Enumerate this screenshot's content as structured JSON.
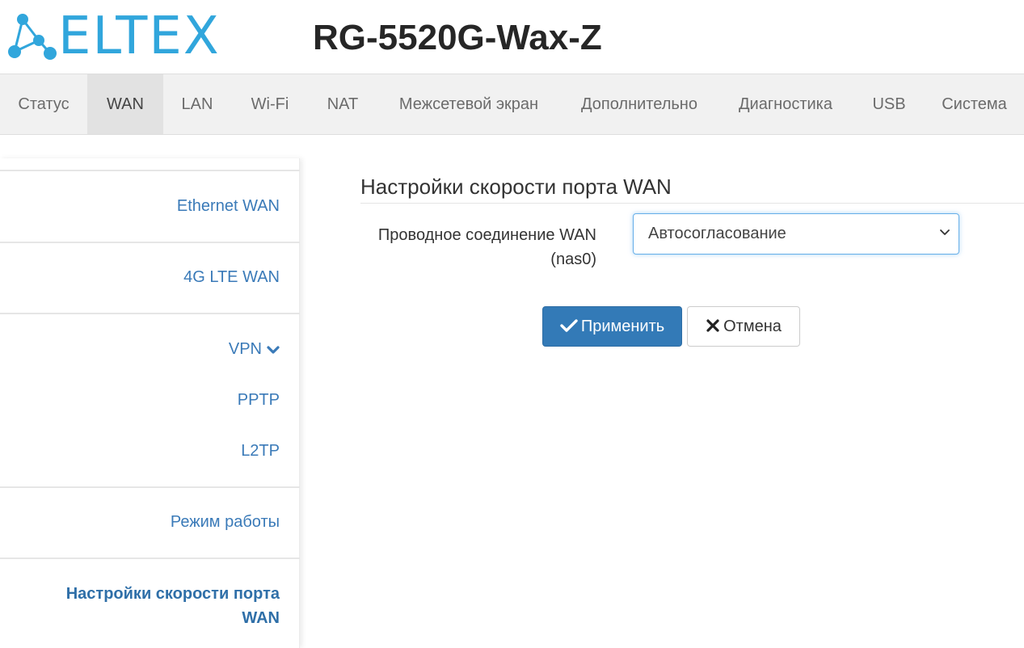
{
  "header": {
    "logo_text": "ELTEX",
    "model": "RG-5520G-Wax-Z"
  },
  "nav": {
    "items": [
      {
        "label": "Статус"
      },
      {
        "label": "WAN"
      },
      {
        "label": "LAN"
      },
      {
        "label": "Wi-Fi"
      },
      {
        "label": "NAT"
      },
      {
        "label": "Межсетевой экран"
      },
      {
        "label": "Дополнительно"
      },
      {
        "label": "Диагностика"
      },
      {
        "label": "USB"
      },
      {
        "label": "Система"
      }
    ],
    "active": "WAN"
  },
  "sidebar": {
    "items": [
      {
        "label": "Ethernet WAN"
      },
      {
        "label": "4G LTE WAN"
      },
      {
        "label": "VPN"
      },
      {
        "label": "PPTP"
      },
      {
        "label": "L2TP"
      },
      {
        "label": "Режим работы"
      },
      {
        "label": "Настройки скорости порта"
      },
      {
        "label": "WAN"
      }
    ]
  },
  "main": {
    "title": "Настройки скорости порта WAN",
    "field_label_line1": "Проводное соединение WAN",
    "field_label_line2": "(nas0)",
    "select_value": "Автосогласование",
    "apply_label": "Применить",
    "cancel_label": "Отмена"
  },
  "colors": {
    "brand": "#31a6dc",
    "link": "#3a7ab8",
    "primary_button": "#337ab7"
  },
  "icons": {
    "logo": "eltex-network-logo",
    "vpn_expand": "chevron-down-icon",
    "select_arrow": "chevron-down-icon",
    "apply": "check-icon",
    "cancel": "close-icon"
  }
}
